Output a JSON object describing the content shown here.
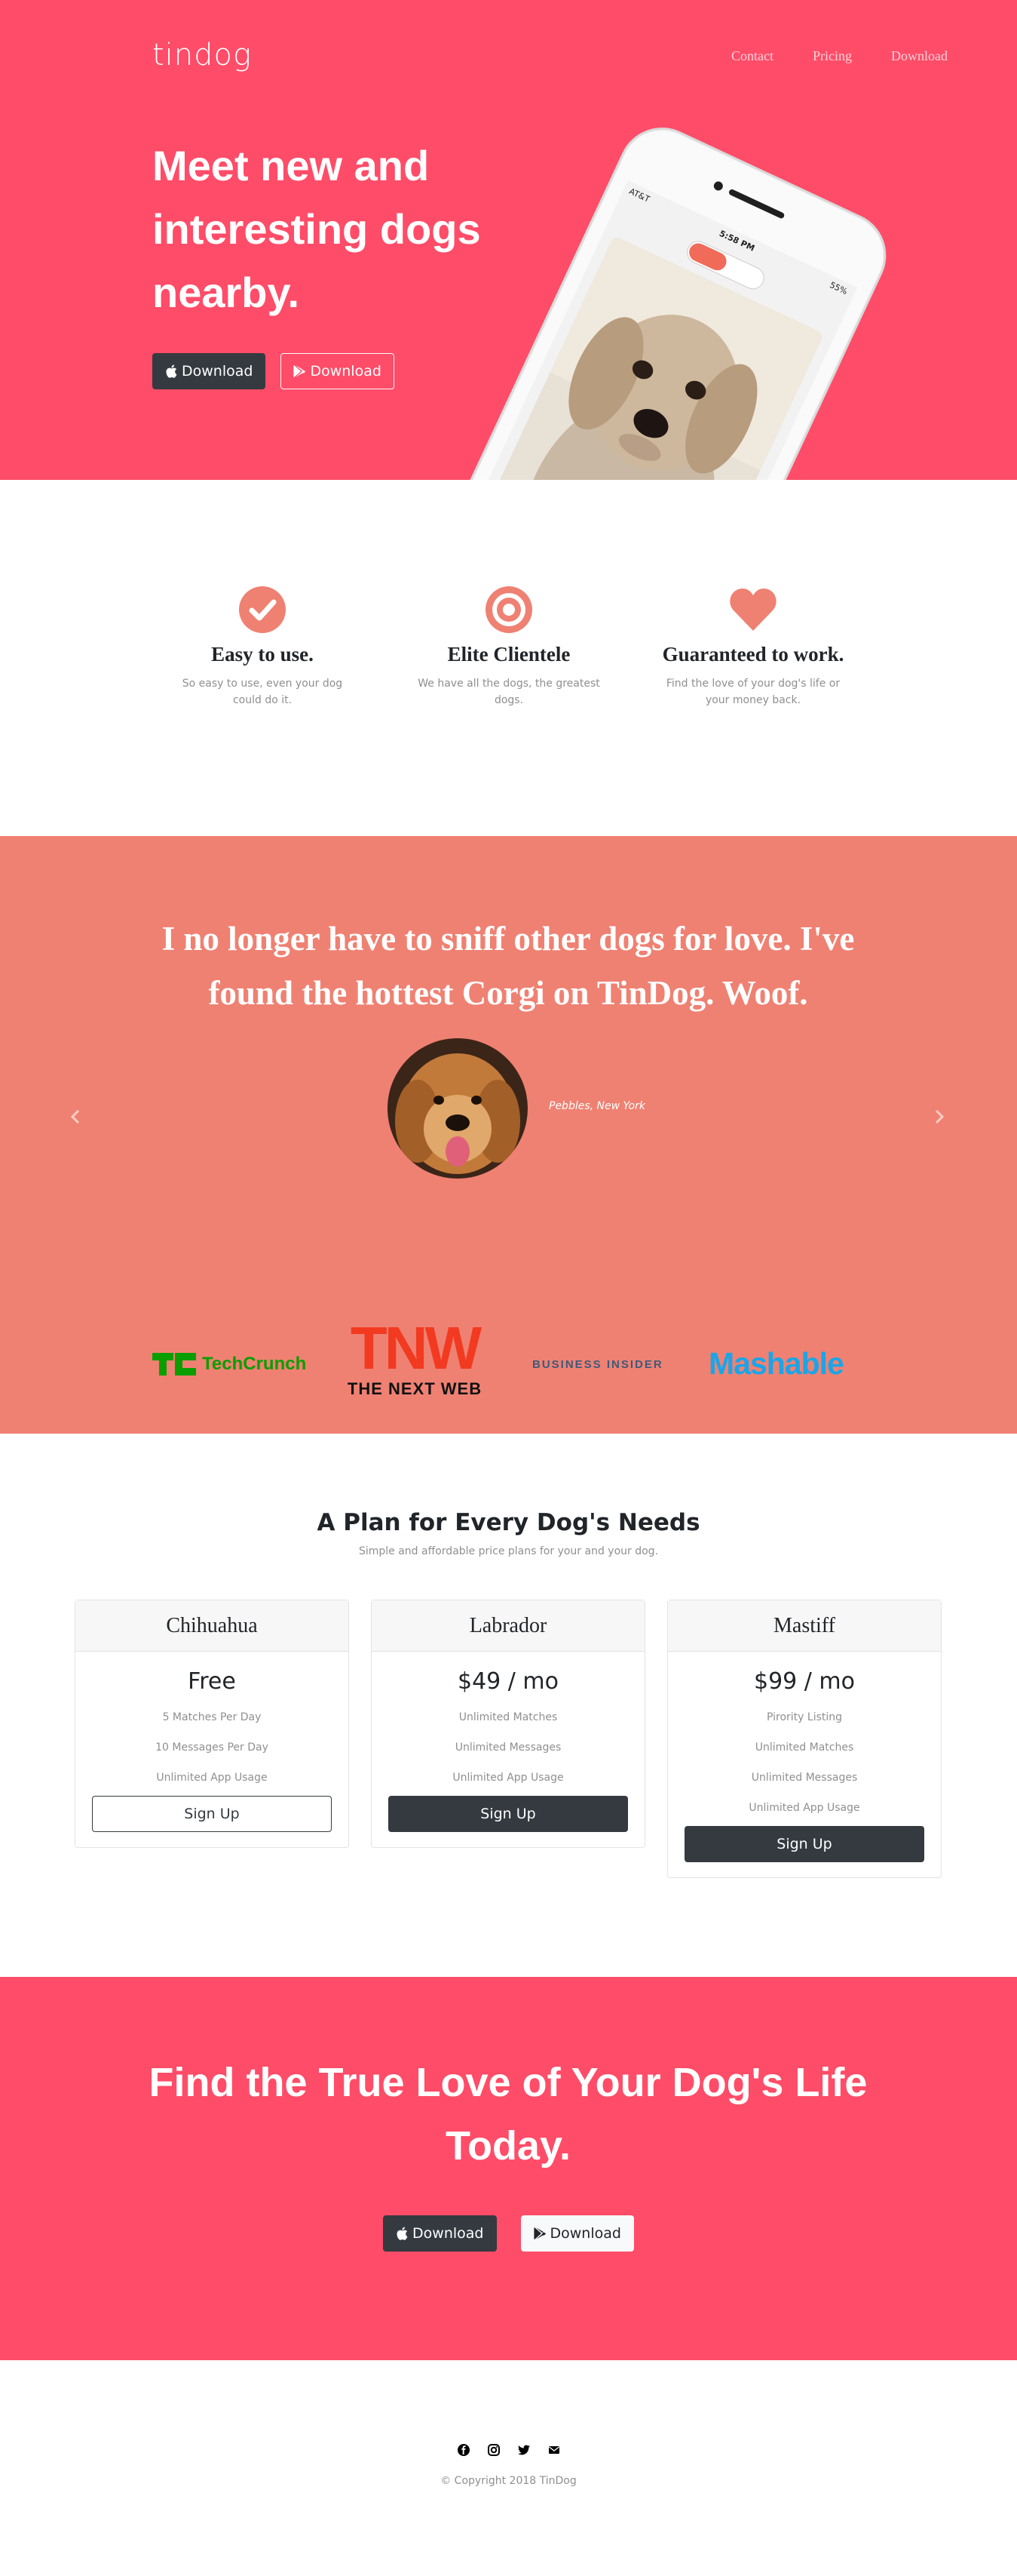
{
  "colors": {
    "hero_bg": "#ff4c68",
    "testimonial_bg": "#ef8172",
    "icon_accent": "#ef8172",
    "button_dark": "#343a40"
  },
  "navbar": {
    "brand": "tindog",
    "links": [
      "Contact",
      "Pricing",
      "Download"
    ]
  },
  "hero": {
    "title": "Meet new and interesting dogs nearby.",
    "buttons": [
      {
        "label": "Download",
        "icon": "apple-icon"
      },
      {
        "label": "Download",
        "icon": "google-play-icon"
      }
    ],
    "phone": {
      "carrier": "AT&T",
      "time": "5:58 PM",
      "battery": "55%"
    }
  },
  "features": [
    {
      "icon": "check-circle-icon",
      "title": "Easy to use.",
      "text": "So easy to use, even your dog could do it."
    },
    {
      "icon": "bullseye-icon",
      "title": "Elite Clientele",
      "text": "We have all the dogs, the greatest dogs."
    },
    {
      "icon": "heart-icon",
      "title": "Guaranteed to work.",
      "text": "Find the love of your dog's life or your money back."
    }
  ],
  "testimonial": {
    "quote": "I no longer have to sniff other dogs for love. I've found the hottest Corgi on TinDog. Woof.",
    "name": "Pebbles, New York"
  },
  "press": {
    "techcrunch": "TechCrunch",
    "tnw": "TNW",
    "tnw_sub": "THE NEXT WEB",
    "business_insider": "BUSINESS INSIDER",
    "mashable": "Mashable"
  },
  "pricing": {
    "title": "A Plan for Every Dog's Needs",
    "subtitle": "Simple and affordable price plans for your and your dog.",
    "plans": [
      {
        "name": "Chihuahua",
        "price": "Free",
        "features": [
          "5 Matches Per Day",
          "10 Messages Per Day",
          "Unlimited App Usage"
        ],
        "button": "Sign Up"
      },
      {
        "name": "Labrador",
        "price": "$49 / mo",
        "features": [
          "Unlimited Matches",
          "Unlimited Messages",
          "Unlimited App Usage"
        ],
        "button": "Sign Up"
      },
      {
        "name": "Mastiff",
        "price": "$99 / mo",
        "features": [
          "Pirority Listing",
          "Unlimited Matches",
          "Unlimited Messages",
          "Unlimited App Usage"
        ],
        "button": "Sign Up"
      }
    ]
  },
  "cta": {
    "title": "Find the True Love of Your Dog's Life Today.",
    "buttons": [
      {
        "label": "Download",
        "icon": "apple-icon"
      },
      {
        "label": "Download",
        "icon": "google-play-icon"
      }
    ]
  },
  "footer": {
    "social_icons": [
      "facebook-icon",
      "instagram-icon",
      "twitter-icon",
      "envelope-icon"
    ],
    "copyright": "© Copyright 2018 TinDog"
  }
}
